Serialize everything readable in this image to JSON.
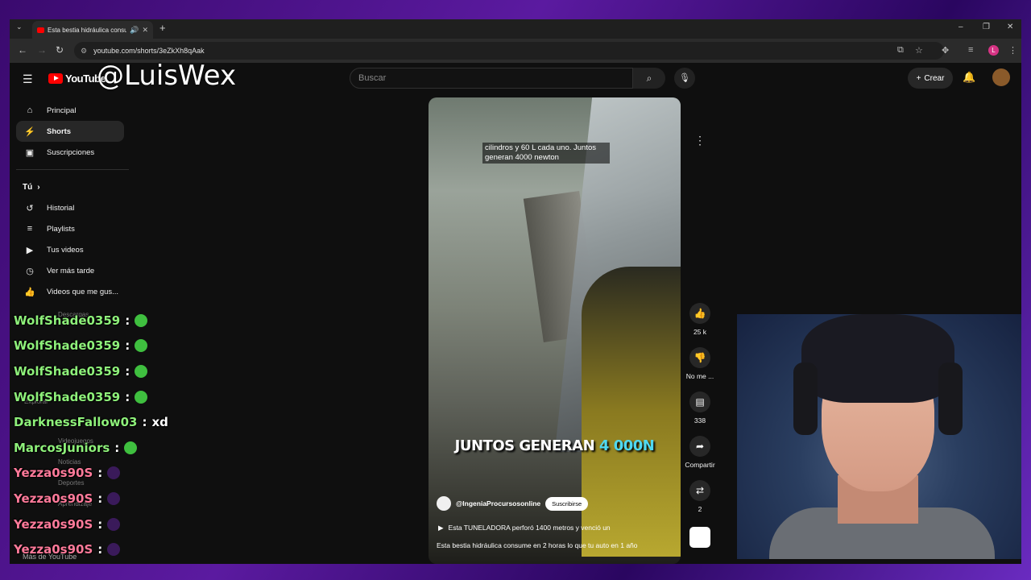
{
  "browser": {
    "tab_title": "Esta bestia hidráulica consu...",
    "url": "youtube.com/shorts/3eZkXh8qAak",
    "profile_initial": "L"
  },
  "youtube": {
    "logo_text": "YouTube",
    "search_placeholder": "Buscar",
    "create_label": "Crear"
  },
  "watermark": "@LuisWex",
  "sidebar": {
    "items_top": [
      {
        "label": "Principal",
        "icon": "home-icon"
      },
      {
        "label": "Shorts",
        "icon": "shorts-icon"
      },
      {
        "label": "Suscripciones",
        "icon": "subscriptions-icon"
      }
    ],
    "you_header": "Tú",
    "items_you": [
      {
        "label": "Historial",
        "icon": "history-icon"
      },
      {
        "label": "Playlists",
        "icon": "playlists-icon"
      },
      {
        "label": "Tus videos",
        "icon": "your-videos-icon"
      },
      {
        "label": "Ver más tarde",
        "icon": "watch-later-icon"
      },
      {
        "label": "Videos que me gus...",
        "icon": "liked-icon"
      }
    ],
    "faded": [
      "Descargas",
      "Explorar",
      "Videojuegos",
      "Noticias",
      "Deportes",
      "Aprendizaje"
    ],
    "more": "Más de YouTube"
  },
  "chat": [
    {
      "user": "WolfShade0359",
      "text": "",
      "color": "#8ef07a"
    },
    {
      "user": "WolfShade0359",
      "text": "",
      "color": "#8ef07a"
    },
    {
      "user": "WolfShade0359",
      "text": "",
      "color": "#8ef07a"
    },
    {
      "user": "WolfShade0359",
      "text": "",
      "color": "#8ef07a"
    },
    {
      "user": "DarknessFallow03",
      "text": "xd",
      "color": "#8ef07a"
    },
    {
      "user": "MarcosJuniors",
      "text": "",
      "color": "#8ef07a"
    },
    {
      "user": "Yezza0s90S",
      "text": "",
      "color": "#ff7a9a"
    },
    {
      "user": "Yezza0s90S",
      "text": "",
      "color": "#ff7a9a"
    },
    {
      "user": "Yezza0s90S",
      "text": "",
      "color": "#ff7a9a"
    },
    {
      "user": "Yezza0s90S",
      "text": "",
      "color": "#ff7a9a"
    }
  ],
  "video": {
    "caption": "cilindros y 60 L cada uno. Juntos generan 4000 newton",
    "big_text_a": "JUNTOS GENERAN ",
    "big_text_b": "4 000N",
    "channel": "@IngeniaProcursosonline",
    "subscribe": "Suscribirse",
    "related": "Esta TUNELADORA perforó 1400 metros y venció un",
    "title": "Esta bestia hidráulica consume en 2 horas lo que tu auto en 1 año",
    "progress": 0.82
  },
  "actions": {
    "likes": "25 k",
    "dislike": "No me ...",
    "comments": "338",
    "share": "Compartir",
    "remix": "2"
  }
}
